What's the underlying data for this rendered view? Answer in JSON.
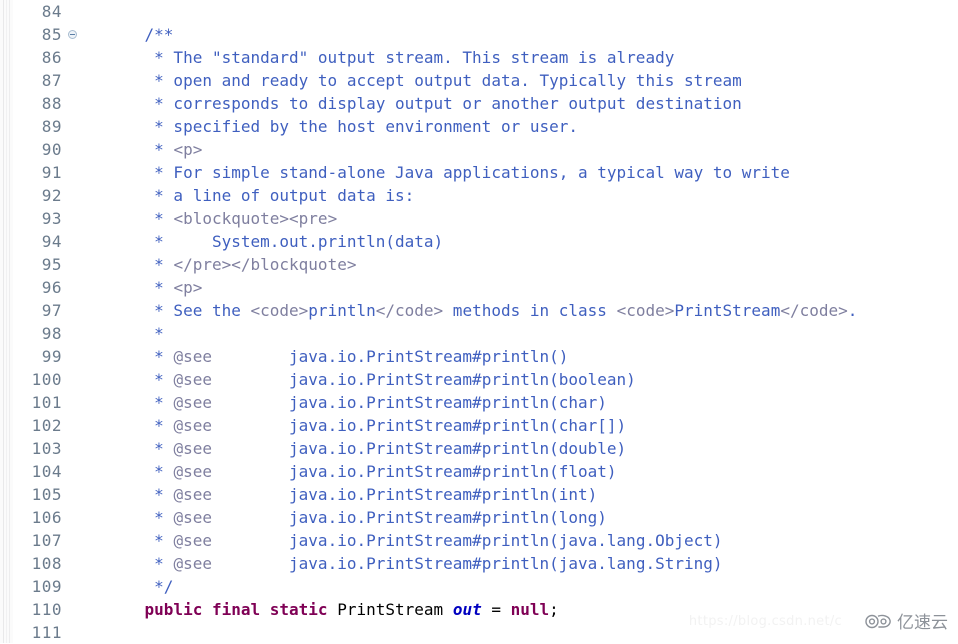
{
  "editor": {
    "language": "Java",
    "first_line_number": 84,
    "background_color": "#ffffff",
    "gutter_color": "#6b7b8c",
    "colors": {
      "javadoc_text": "#3f5fbf",
      "javadoc_tag": "#7f7f9f",
      "keyword": "#7f0055",
      "field": "#0000c0",
      "plain": "#000000"
    },
    "fold_marker_line": 85,
    "fold_marker_icon": "collapse-circle-minus-icon"
  },
  "lines": [
    {
      "num": "84",
      "fold": false,
      "tokens": []
    },
    {
      "num": "85",
      "fold": true,
      "tokens": [
        {
          "c": "doc",
          "t": "    /**"
        }
      ]
    },
    {
      "num": "86",
      "fold": false,
      "tokens": [
        {
          "c": "doc",
          "t": "     * The \"standard\" output stream. This stream is already"
        }
      ]
    },
    {
      "num": "87",
      "fold": false,
      "tokens": [
        {
          "c": "doc",
          "t": "     * open and ready to accept output data. Typically this stream"
        }
      ]
    },
    {
      "num": "88",
      "fold": false,
      "tokens": [
        {
          "c": "doc",
          "t": "     * corresponds to display output or another output destination"
        }
      ]
    },
    {
      "num": "89",
      "fold": false,
      "tokens": [
        {
          "c": "doc",
          "t": "     * specified by the host environment or user."
        }
      ]
    },
    {
      "num": "90",
      "fold": false,
      "tokens": [
        {
          "c": "doc",
          "t": "     * "
        },
        {
          "c": "doctag",
          "t": "<p>"
        }
      ]
    },
    {
      "num": "91",
      "fold": false,
      "tokens": [
        {
          "c": "doc",
          "t": "     * For simple stand-alone Java applications, a typical way to write"
        }
      ]
    },
    {
      "num": "92",
      "fold": false,
      "tokens": [
        {
          "c": "doc",
          "t": "     * a line of output data is:"
        }
      ]
    },
    {
      "num": "93",
      "fold": false,
      "tokens": [
        {
          "c": "doc",
          "t": "     * "
        },
        {
          "c": "doctag",
          "t": "<blockquote><pre>"
        }
      ]
    },
    {
      "num": "94",
      "fold": false,
      "tokens": [
        {
          "c": "doc",
          "t": "     *     System.out.println(data)"
        }
      ]
    },
    {
      "num": "95",
      "fold": false,
      "tokens": [
        {
          "c": "doc",
          "t": "     * "
        },
        {
          "c": "doctag",
          "t": "</pre></blockquote>"
        }
      ]
    },
    {
      "num": "96",
      "fold": false,
      "tokens": [
        {
          "c": "doc",
          "t": "     * "
        },
        {
          "c": "doctag",
          "t": "<p>"
        }
      ]
    },
    {
      "num": "97",
      "fold": false,
      "tokens": [
        {
          "c": "doc",
          "t": "     * See the "
        },
        {
          "c": "doctag",
          "t": "<code>"
        },
        {
          "c": "doc",
          "t": "println"
        },
        {
          "c": "doctag",
          "t": "</code>"
        },
        {
          "c": "doc",
          "t": " methods in class "
        },
        {
          "c": "doctag",
          "t": "<code>"
        },
        {
          "c": "doc",
          "t": "PrintStream"
        },
        {
          "c": "doctag",
          "t": "</code>"
        },
        {
          "c": "doc",
          "t": "."
        }
      ]
    },
    {
      "num": "98",
      "fold": false,
      "tokens": [
        {
          "c": "doc",
          "t": "     *"
        }
      ]
    },
    {
      "num": "99",
      "fold": false,
      "tokens": [
        {
          "c": "doc",
          "t": "     * "
        },
        {
          "c": "doctag",
          "t": "@see"
        },
        {
          "c": "doc",
          "t": "        java.io.PrintStream#println()"
        }
      ]
    },
    {
      "num": "100",
      "fold": false,
      "tokens": [
        {
          "c": "doc",
          "t": "     * "
        },
        {
          "c": "doctag",
          "t": "@see"
        },
        {
          "c": "doc",
          "t": "        java.io.PrintStream#println(boolean)"
        }
      ]
    },
    {
      "num": "101",
      "fold": false,
      "tokens": [
        {
          "c": "doc",
          "t": "     * "
        },
        {
          "c": "doctag",
          "t": "@see"
        },
        {
          "c": "doc",
          "t": "        java.io.PrintStream#println(char)"
        }
      ]
    },
    {
      "num": "102",
      "fold": false,
      "tokens": [
        {
          "c": "doc",
          "t": "     * "
        },
        {
          "c": "doctag",
          "t": "@see"
        },
        {
          "c": "doc",
          "t": "        java.io.PrintStream#println(char[])"
        }
      ]
    },
    {
      "num": "103",
      "fold": false,
      "tokens": [
        {
          "c": "doc",
          "t": "     * "
        },
        {
          "c": "doctag",
          "t": "@see"
        },
        {
          "c": "doc",
          "t": "        java.io.PrintStream#println(double)"
        }
      ]
    },
    {
      "num": "104",
      "fold": false,
      "tokens": [
        {
          "c": "doc",
          "t": "     * "
        },
        {
          "c": "doctag",
          "t": "@see"
        },
        {
          "c": "doc",
          "t": "        java.io.PrintStream#println(float)"
        }
      ]
    },
    {
      "num": "105",
      "fold": false,
      "tokens": [
        {
          "c": "doc",
          "t": "     * "
        },
        {
          "c": "doctag",
          "t": "@see"
        },
        {
          "c": "doc",
          "t": "        java.io.PrintStream#println(int)"
        }
      ]
    },
    {
      "num": "106",
      "fold": false,
      "tokens": [
        {
          "c": "doc",
          "t": "     * "
        },
        {
          "c": "doctag",
          "t": "@see"
        },
        {
          "c": "doc",
          "t": "        java.io.PrintStream#println(long)"
        }
      ]
    },
    {
      "num": "107",
      "fold": false,
      "tokens": [
        {
          "c": "doc",
          "t": "     * "
        },
        {
          "c": "doctag",
          "t": "@see"
        },
        {
          "c": "doc",
          "t": "        java.io.PrintStream#println(java.lang.Object)"
        }
      ]
    },
    {
      "num": "108",
      "fold": false,
      "tokens": [
        {
          "c": "doc",
          "t": "     * "
        },
        {
          "c": "doctag",
          "t": "@see"
        },
        {
          "c": "doc",
          "t": "        java.io.PrintStream#println(java.lang.String)"
        }
      ]
    },
    {
      "num": "109",
      "fold": false,
      "tokens": [
        {
          "c": "doc",
          "t": "     */"
        }
      ]
    },
    {
      "num": "110",
      "fold": false,
      "tokens": [
        {
          "c": "plain",
          "t": "    "
        },
        {
          "c": "kw",
          "t": "public final static"
        },
        {
          "c": "plain",
          "t": " "
        },
        {
          "c": "type",
          "t": "PrintStream"
        },
        {
          "c": "plain",
          "t": " "
        },
        {
          "c": "field",
          "t": "out"
        },
        {
          "c": "plain",
          "t": " = "
        },
        {
          "c": "null",
          "t": "null"
        },
        {
          "c": "plain",
          "t": ";"
        }
      ]
    },
    {
      "num": "111",
      "fold": false,
      "tokens": []
    }
  ],
  "watermarks": {
    "url": "https://blog.csdn.net/c",
    "logo_text": "亿速云",
    "logo_icon": "cloud-icon"
  }
}
